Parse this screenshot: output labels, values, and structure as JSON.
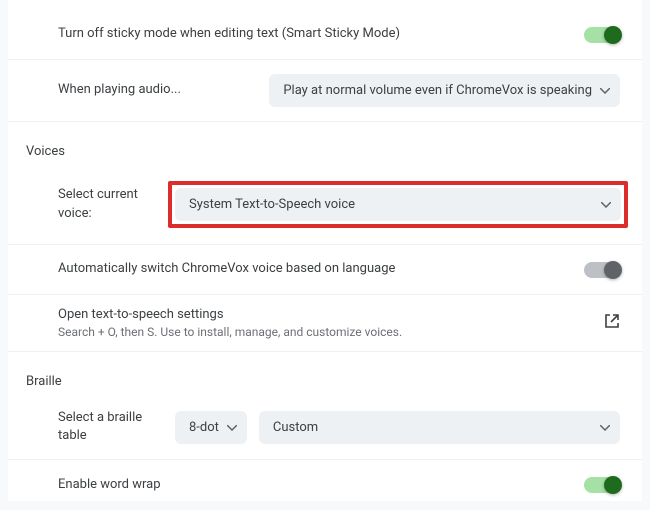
{
  "smartSticky": {
    "label": "Turn off sticky mode when editing text (Smart Sticky Mode)",
    "enabled": true
  },
  "audioPlay": {
    "label": "When playing audio...",
    "selected": "Play at normal volume even if ChromeVox is speaking"
  },
  "voicesSection": "Voices",
  "selectVoice": {
    "label": "Select current voice:",
    "selected": "System Text-to-Speech voice"
  },
  "autoSwitch": {
    "label": "Automatically switch ChromeVox voice based on language",
    "enabled": false
  },
  "tts": {
    "title": "Open text-to-speech settings",
    "sub": "Search + O, then S. Use to install, manage, and customize voices."
  },
  "brailleSection": "Braille",
  "brailleTable": {
    "label": "Select a braille table",
    "dots": "8-dot",
    "custom": "Custom"
  },
  "wordWrap": {
    "label": "Enable word wrap",
    "enabled": true
  }
}
